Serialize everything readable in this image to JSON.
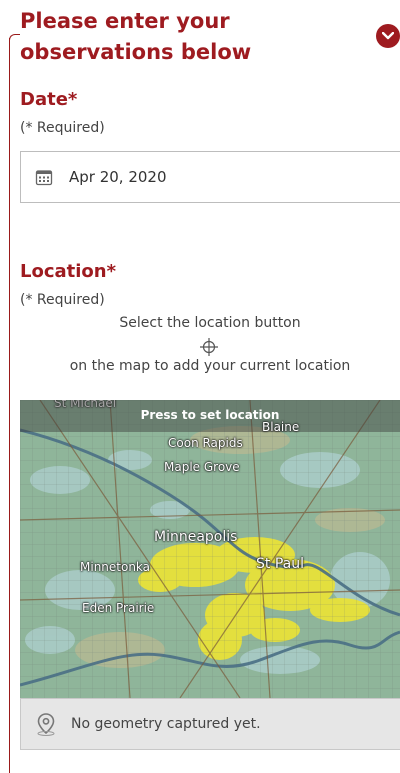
{
  "section": {
    "title": "Please enter your observations below"
  },
  "date_field": {
    "label": "Date*",
    "hint": "(* Required)",
    "value": "Apr 20, 2020"
  },
  "location_field": {
    "label": "Location*",
    "hint": "(* Required)",
    "instruction_top": "Select the location button",
    "instruction_bottom": "on the map to add your current location"
  },
  "map": {
    "banner": "Press to set location",
    "places": {
      "st_michael": "St Michael",
      "blaine": "Blaine",
      "coon_rapids": "Coon Rapids",
      "maple_grove": "Maple Grove",
      "minneapolis": "Minneapolis",
      "st_paul": "St Paul",
      "minnetonka": "Minnetonka",
      "eden_prairie": "Eden Prairie"
    }
  },
  "status": {
    "text": "No geometry captured yet."
  },
  "colors": {
    "accent": "#9e1b20"
  }
}
